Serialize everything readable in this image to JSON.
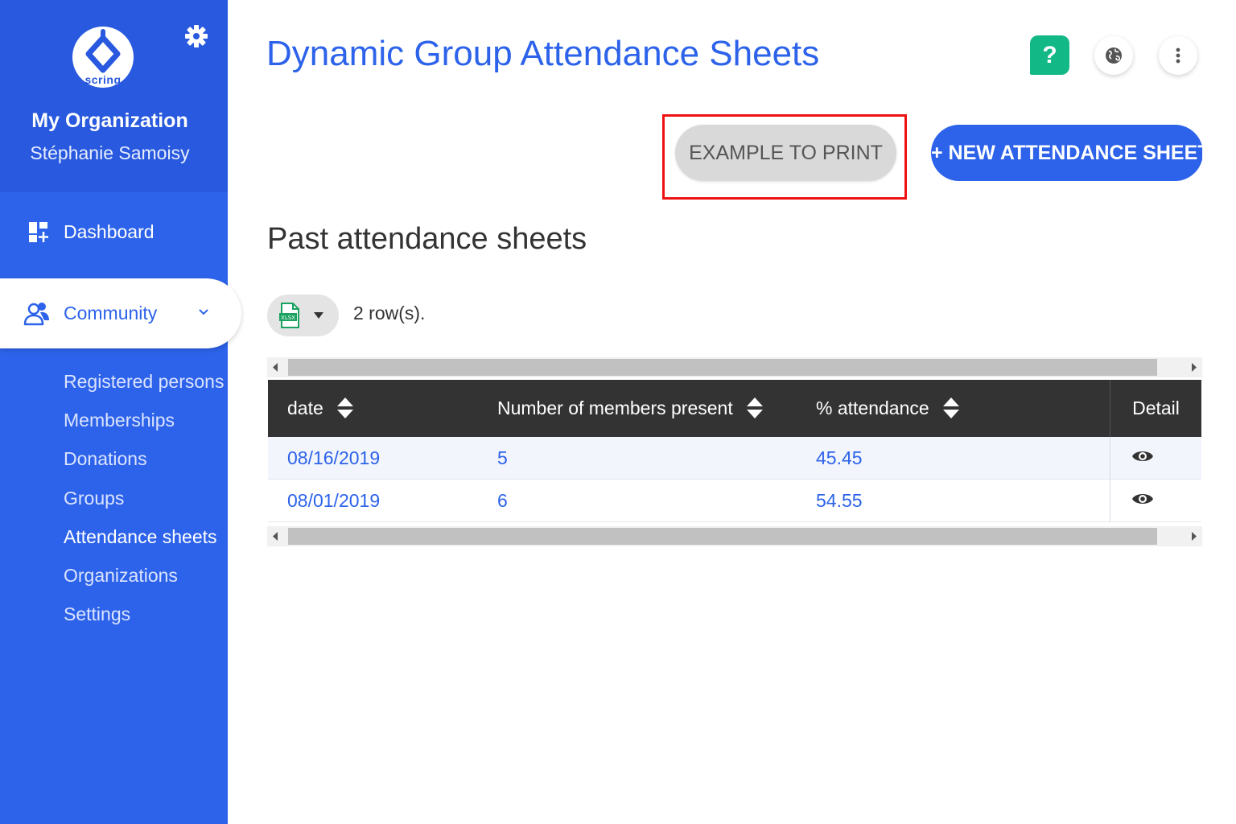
{
  "sidebar": {
    "logo_text": "scring",
    "org_name": "My Organization",
    "user_name": "Stéphanie Samoisy",
    "dashboard_label": "Dashboard",
    "community_label": "Community",
    "sub_items": [
      {
        "label": "Registered persons"
      },
      {
        "label": "Memberships"
      },
      {
        "label": "Donations"
      },
      {
        "label": "Groups"
      },
      {
        "label": "Attendance sheets",
        "active": true
      },
      {
        "label": "Organizations"
      },
      {
        "label": "Settings"
      }
    ]
  },
  "header": {
    "title": "Dynamic Group Attendance Sheets",
    "help_label": "?",
    "icons": [
      "help-icon",
      "globe-icon",
      "more-vertical-icon"
    ]
  },
  "actions": {
    "example_label": "EXAMPLE TO PRINT",
    "new_label": "+ NEW ATTENDANCE SHEET"
  },
  "section": {
    "title": "Past attendance sheets",
    "row_count": "2 row(s).",
    "export_icon": "xlsx-icon"
  },
  "table": {
    "columns": [
      "date",
      "Number of members present",
      "% attendance",
      "Detail"
    ],
    "rows": [
      {
        "date": "08/16/2019",
        "members": "5",
        "attendance": "45.45"
      },
      {
        "date": "08/01/2019",
        "members": "6",
        "attendance": "54.55"
      }
    ]
  },
  "colors": {
    "primary": "#2d63ea",
    "sidebar_header": "#2859de",
    "help_green": "#12b886",
    "table_header": "#333333",
    "highlight_red": "#ee1111"
  }
}
